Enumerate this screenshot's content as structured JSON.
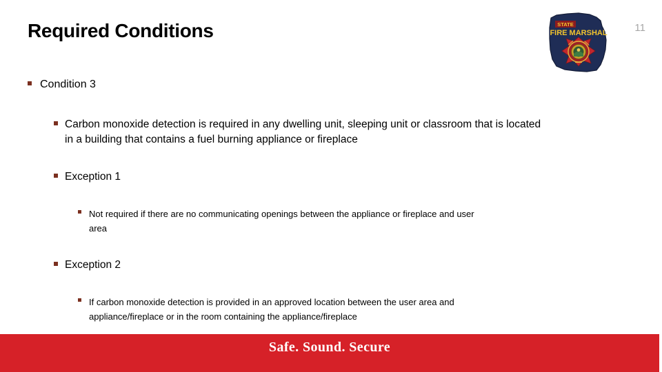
{
  "slide": {
    "title": "Required Conditions",
    "page_number": "11",
    "bullet_glyph": "square-bullet",
    "bullet_color": "#7B3020",
    "text_color": "#000000",
    "background": "#ffffff"
  },
  "logo": {
    "name": "ohio-state-fire-marshal-badge",
    "line1": "STATE",
    "line2": "FIRE MARSHAL",
    "outline_color": "#1F2D56",
    "cross_color": "#C1272D",
    "text_color": "#F2C42E",
    "seal_color": "#C8A02A"
  },
  "content": {
    "level1": {
      "text": "Condition 3"
    },
    "level2_a": {
      "text": "Carbon monoxide detection is required in any dwelling unit, sleeping unit or classroom that is located in a building that contains a fuel burning appliance or fireplace"
    },
    "exception1": {
      "heading": "Exception 1",
      "line1": "Not required if there are no communicating openings between the appliance or fireplace and user",
      "line2": "area"
    },
    "exception2": {
      "heading": "Exception 2",
      "line1": "If carbon monoxide detection is provided in an approved location between the user area and",
      "line2": "appliance/fireplace or in the room containing the appliance/fireplace"
    }
  },
  "footer": {
    "tagline": "Safe. Sound. Secure",
    "background": "#D62128",
    "text_color": "#ffffff"
  }
}
